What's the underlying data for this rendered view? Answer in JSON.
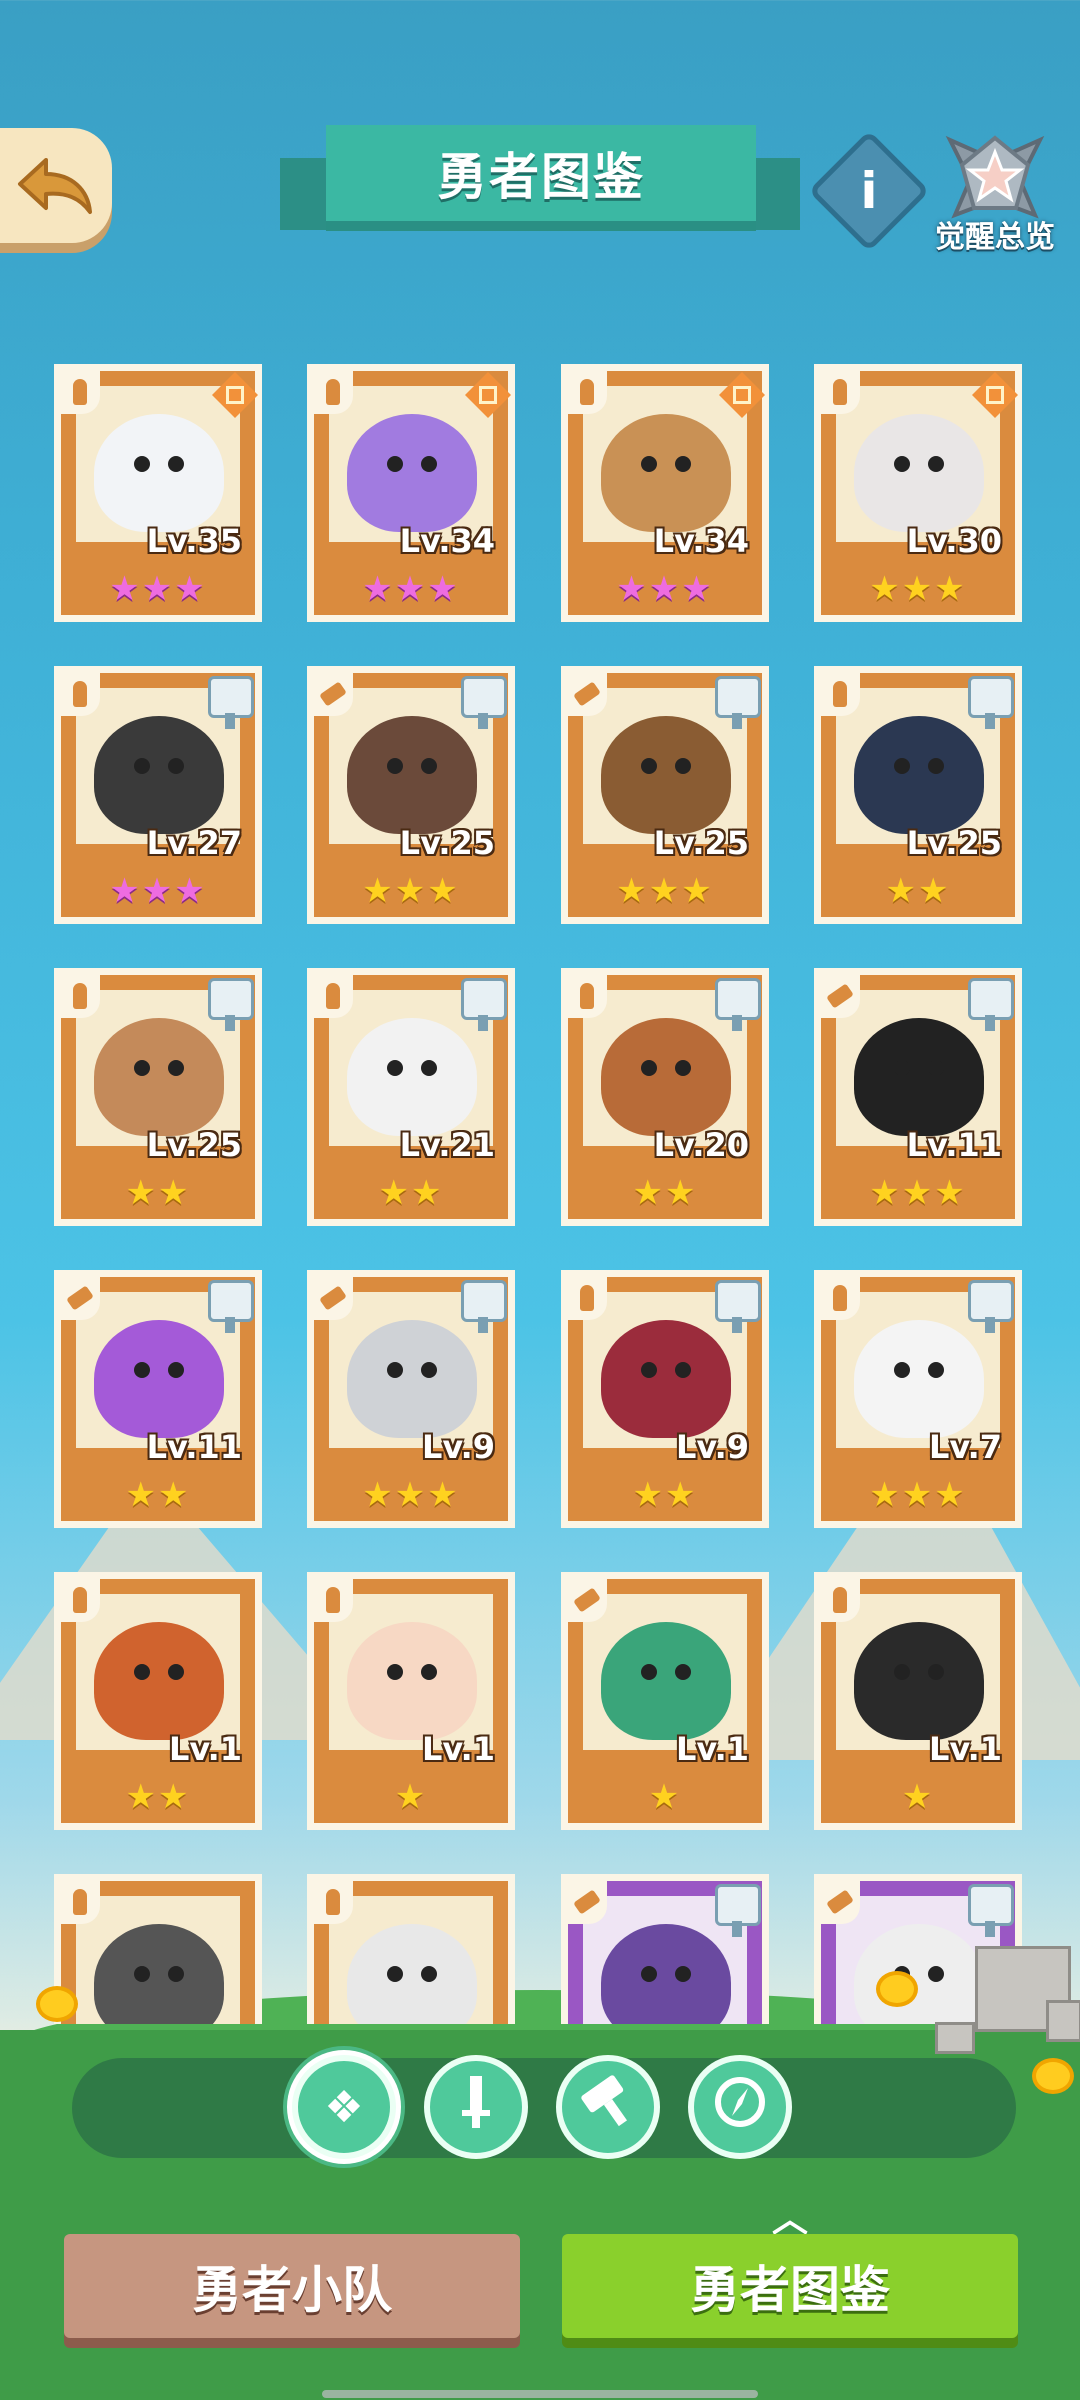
{
  "header": {
    "title": "勇者图鉴",
    "awaken_label": "觉醒总览",
    "info_glyph": "i",
    "back_icon": "back-arrow-icon"
  },
  "heroes": [
    {
      "level": "Lv.35",
      "stars": "★★★",
      "star_color": "pink",
      "frame": "orange",
      "class": "sword",
      "badge": "ornament",
      "color": "#f2f4f7"
    },
    {
      "level": "Lv.34",
      "stars": "★★★",
      "star_color": "pink",
      "frame": "orange",
      "class": "sword",
      "badge": "ornament",
      "color": "#a17be0"
    },
    {
      "level": "Lv.34",
      "stars": "★★★",
      "star_color": "pink",
      "frame": "orange",
      "class": "sword",
      "badge": "ornament",
      "color": "#c99155"
    },
    {
      "level": "Lv.30",
      "stars": "★★★",
      "star_color": "gold",
      "frame": "orange",
      "class": "sword",
      "badge": "ornament",
      "color": "#e9e6e6"
    },
    {
      "level": "Lv.27",
      "stars": "★★★",
      "star_color": "pink",
      "frame": "orange",
      "class": "sword",
      "badge": "anvil",
      "color": "#3a3a3a"
    },
    {
      "level": "Lv.25",
      "stars": "★★★",
      "star_color": "gold",
      "frame": "orange",
      "class": "hammer",
      "badge": "anvil",
      "color": "#6b4a3a"
    },
    {
      "level": "Lv.25",
      "stars": "★★★",
      "star_color": "gold",
      "frame": "orange",
      "class": "hammer",
      "badge": "anvil",
      "color": "#8a5c33"
    },
    {
      "level": "Lv.25",
      "stars": "★★",
      "star_color": "gold",
      "frame": "orange",
      "class": "sword",
      "badge": "anvil",
      "color": "#2b3852"
    },
    {
      "level": "Lv.25",
      "stars": "★★",
      "star_color": "gold",
      "frame": "orange",
      "class": "sword",
      "badge": "anvil",
      "color": "#c48a5a"
    },
    {
      "level": "Lv.21",
      "stars": "★★",
      "star_color": "gold",
      "frame": "orange",
      "class": "sword",
      "badge": "anvil",
      "color": "#f2f2f2"
    },
    {
      "level": "Lv.20",
      "stars": "★★",
      "star_color": "gold",
      "frame": "orange",
      "class": "sword",
      "badge": "anvil",
      "color": "#b86b38"
    },
    {
      "level": "Lv.11",
      "stars": "★★★",
      "star_color": "gold",
      "frame": "orange",
      "class": "hammer",
      "badge": "anvil",
      "color": "#222222"
    },
    {
      "level": "Lv.11",
      "stars": "★★",
      "star_color": "gold",
      "frame": "orange",
      "class": "hammer",
      "badge": "anvil",
      "color": "#a45ad8"
    },
    {
      "level": "Lv.9",
      "stars": "★★★",
      "star_color": "gold",
      "frame": "orange",
      "class": "hammer",
      "badge": "anvil",
      "color": "#cfd2d6"
    },
    {
      "level": "Lv.9",
      "stars": "★★",
      "star_color": "gold",
      "frame": "orange",
      "class": "sword",
      "badge": "anvil",
      "color": "#9b2c3c"
    },
    {
      "level": "Lv.7",
      "stars": "★★★",
      "star_color": "gold",
      "frame": "orange",
      "class": "sword",
      "badge": "anvil",
      "color": "#f4f4f4"
    },
    {
      "level": "Lv.1",
      "stars": "★★",
      "star_color": "gold",
      "frame": "orange",
      "class": "sword",
      "badge": "none",
      "color": "#d0632e"
    },
    {
      "level": "Lv.1",
      "stars": "★",
      "star_color": "gold",
      "frame": "orange",
      "class": "sword",
      "badge": "none",
      "color": "#f7d8c4"
    },
    {
      "level": "Lv.1",
      "stars": "★",
      "star_color": "gold",
      "frame": "orange",
      "class": "hammer",
      "badge": "none",
      "color": "#3aa57a"
    },
    {
      "level": "Lv.1",
      "stars": "★",
      "star_color": "gold",
      "frame": "orange",
      "class": "sword",
      "badge": "none",
      "color": "#2a2a2a"
    },
    {
      "level": "",
      "stars": "",
      "star_color": "gold",
      "frame": "orange",
      "class": "sword",
      "badge": "none",
      "color": "#555555"
    },
    {
      "level": "",
      "stars": "",
      "star_color": "gold",
      "frame": "orange",
      "class": "sword",
      "badge": "none",
      "color": "#e8e8e8"
    },
    {
      "level": "",
      "stars": "",
      "star_color": "gold",
      "frame": "purple",
      "class": "hammer",
      "badge": "anvil",
      "color": "#6a4aa0"
    },
    {
      "level": "",
      "stars": "",
      "star_color": "gold",
      "frame": "purple",
      "class": "hammer",
      "badge": "anvil",
      "color": "#eeeeee"
    }
  ],
  "filters": [
    {
      "icon": "all-classes-icon",
      "glyph": "❖",
      "selected": true
    },
    {
      "icon": "sword-class-icon",
      "glyph": "🗡",
      "selected": false
    },
    {
      "icon": "hammer-class-icon",
      "glyph": "⚒",
      "selected": false
    },
    {
      "icon": "compass-class-icon",
      "glyph": "⊘",
      "selected": false
    }
  ],
  "bottom_tabs": {
    "team": "勇者小队",
    "codex": "勇者图鉴"
  },
  "colors": {
    "accent_teal": "#3bb8a3",
    "card_orange": "#da8b3e",
    "card_purple": "#9a57c4",
    "tab_green": "#8ad02c",
    "tab_brown": "#c69680"
  }
}
